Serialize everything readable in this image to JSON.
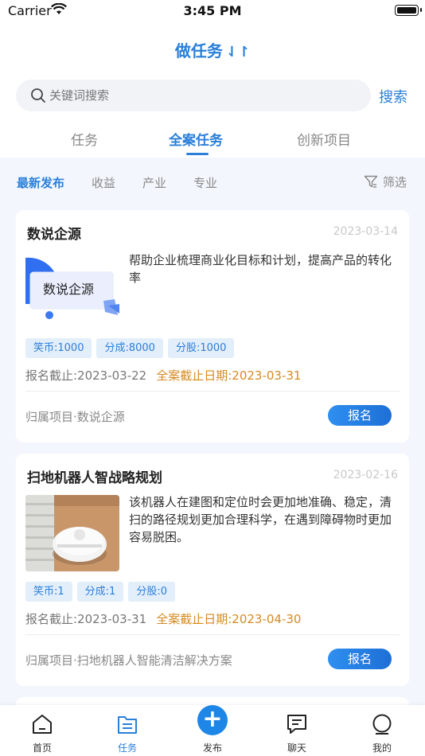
{
  "status": {
    "carrier": "Carrier",
    "time": "3:45 PM"
  },
  "header": {
    "title": "做任务",
    "swap_icon": "⇃↾"
  },
  "search": {
    "placeholder": "关键词搜索",
    "button": "搜索"
  },
  "tabs": [
    "任务",
    "全案任务",
    "创新项目"
  ],
  "active_tab": 1,
  "filters": [
    "最新发布",
    "收益",
    "产业",
    "专业"
  ],
  "filter_button": "筛选",
  "cards": [
    {
      "title": "数说企源",
      "date": "2023-03-14",
      "description": "帮助企业梳理商业化目标和计划，提高产品的转化率",
      "thumb_text": "数说企源",
      "tags": [
        "笑币:1000",
        "分成:8000",
        "分股:1000"
      ],
      "signup_deadline": "报名截止:2023-03-22",
      "final_deadline": "全案截止日期:2023-03-31",
      "project": "归属项目·数说企源",
      "action": "报名"
    },
    {
      "title": "扫地机器人智战略规划",
      "date": "2023-02-16",
      "description": "该机器人在建图和定位时会更加地准确、稳定，清扫的路径规划更加合理科学，在遇到障碍物时更加容易脱困。",
      "tags": [
        "笑币:1",
        "分成:1",
        "分股:0"
      ],
      "signup_deadline": "报名截止:2023-03-31",
      "final_deadline": "全案截止日期:2023-04-30",
      "project": "归属项目·扫地机器人智能清洁解决方案",
      "action": "报名"
    }
  ],
  "tabbar": [
    {
      "label": "首页",
      "icon": "home-icon"
    },
    {
      "label": "任务",
      "icon": "task-icon"
    },
    {
      "label": "发布",
      "icon": "plus-icon"
    },
    {
      "label": "聊天",
      "icon": "chat-icon"
    },
    {
      "label": "我的",
      "icon": "profile-icon"
    }
  ],
  "colors": {
    "accent": "#2a7fd9",
    "deadline": "#d58a22",
    "tag_bg": "#e3eefb"
  }
}
